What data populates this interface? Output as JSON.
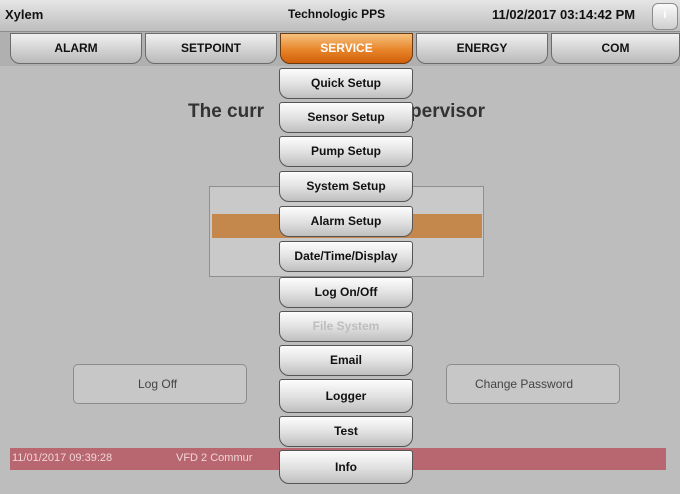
{
  "header": {
    "app_name": "Xylem",
    "product": "Technologic PPS",
    "datetime": "11/02/2017 03:14:42 PM",
    "info_label": "i"
  },
  "tabs": [
    {
      "label": "ALARM",
      "active": false
    },
    {
      "label": "SETPOINT",
      "active": false
    },
    {
      "label": "SERVICE",
      "active": true
    },
    {
      "label": "ENERGY",
      "active": false
    },
    {
      "label": "COM",
      "active": false
    }
  ],
  "main": {
    "user_text_left": "The curr",
    "user_text_right": "pervisor",
    "logoff_label": "Log Off",
    "change_password_label": "Change Password"
  },
  "alarm_bar": {
    "time": "11/01/2017 09:39:28",
    "message": "VFD 2 Commur"
  },
  "service_menu": [
    {
      "label": "Quick Setup",
      "enabled": true
    },
    {
      "label": "Sensor Setup",
      "enabled": true
    },
    {
      "label": "Pump Setup",
      "enabled": true
    },
    {
      "label": "System Setup",
      "enabled": true
    },
    {
      "label": "Alarm Setup",
      "enabled": true
    },
    {
      "label": "Date/Time/Display",
      "enabled": true
    },
    {
      "label": "Log On/Off",
      "enabled": true
    },
    {
      "label": "File System",
      "enabled": false
    },
    {
      "label": "Email",
      "enabled": true
    },
    {
      "label": "Logger",
      "enabled": true
    },
    {
      "label": "Test",
      "enabled": true
    },
    {
      "label": "Info",
      "enabled": true
    }
  ],
  "colors": {
    "active_tab": "#e8842a",
    "alarm_bar": "#b86770",
    "user_row_highlight": "#c4884d",
    "background": "#bdbdbd"
  }
}
